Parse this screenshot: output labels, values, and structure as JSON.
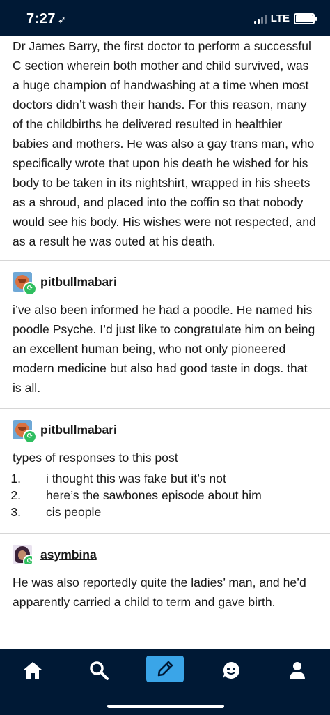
{
  "status_bar": {
    "time": "7:27",
    "network": "LTE"
  },
  "post": {
    "op_text": "Dr James Barry, the first doctor to perform a successful C section wherein both mother and child survived, was a huge champion of handwashing at a time when most doctors didn’t wash their hands. For this reason, many of the childbirths he delivered resulted in healthier babies and mothers. He was also a gay trans man, who specifically wrote that upon his death he wished for his body to be taken in its nightshirt, wrapped in his sheets as a shroud, and placed into the coffin so that nobody would see his body. His wishes were not respected, and as a result he was outed at his death.",
    "reblogs": [
      {
        "username": "pitbullmabari",
        "text": "i’ve also been informed he had a poodle. He named his poodle Psyche. I’d just like to congratulate him on being an excellent human being, who not only pioneered modern medicine but also had good taste in dogs. that is all."
      },
      {
        "username": "pitbullmabari",
        "intro": "types of responses to this post",
        "list": [
          {
            "num": "1.",
            "text": "i thought this was fake but it’s not"
          },
          {
            "num": "2.",
            "text": "here’s the sawbones episode about him"
          },
          {
            "num": "3.",
            "text": "cis people"
          }
        ]
      },
      {
        "username": "asymbina",
        "text": "He was also reportedly quite the ladies’ man, and he’d apparently carried a child to term and gave birth."
      }
    ]
  },
  "tab_bar": {
    "items": [
      "home-icon",
      "search-icon",
      "compose-icon",
      "activity-icon",
      "account-icon"
    ],
    "accent": "#3aa5e8",
    "background": "#001935"
  }
}
